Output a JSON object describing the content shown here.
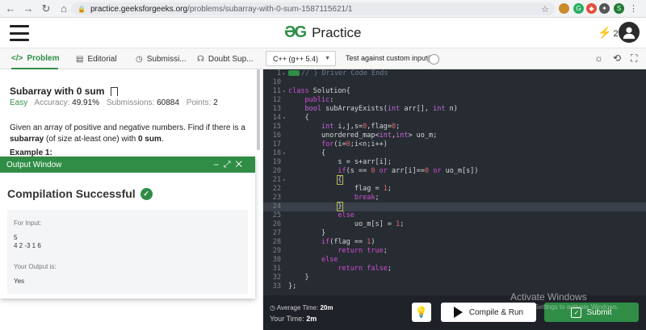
{
  "browser": {
    "url_domain": "practice.geeksforgeeks.org",
    "url_path": "/problems/subarray-with-0-sum-1587115621/1",
    "profile_initial": "S"
  },
  "header": {
    "logo_text": "Practice",
    "streak_count": "2"
  },
  "tabs": [
    {
      "label": "Problem",
      "icon": "code-icon"
    },
    {
      "label": "Editorial",
      "icon": "book-icon"
    },
    {
      "label": "Submissi...",
      "icon": "clock-icon"
    },
    {
      "label": "Doubt Sup...",
      "icon": "headset-icon"
    }
  ],
  "editor_toolbar": {
    "language": "C++ (g++ 5.4)",
    "custom_input_label": "Test against custom input"
  },
  "problem": {
    "title": "Subarray with 0 sum",
    "difficulty": "Easy",
    "accuracy_label": "Accuracy:",
    "accuracy": "49.91%",
    "submissions_label": "Submissions:",
    "submissions": "60884",
    "points_label": "Points:",
    "points": "2",
    "desc_1": "Given an array of positive and negative numbers. Find if there is a ",
    "desc_bold_1": "subarray",
    "desc_2": " (of size at-least one) with ",
    "desc_bold_2": "0 sum",
    "desc_3": ".",
    "example_label": "Example 1:"
  },
  "output": {
    "title": "Output Window",
    "status": "Compilation Successful",
    "for_input_label": "For Input:",
    "input_line_1": "5",
    "input_line_2": "4 2 -3 1 6",
    "your_output_label": "Your Output is:",
    "output_value": "Yes"
  },
  "code": {
    "line_numbers": [
      "1",
      "10",
      "11",
      "12",
      "13",
      "14",
      "15",
      "16",
      "17",
      "18",
      "19",
      "20",
      "21",
      "22",
      "23",
      "24",
      "25",
      "26",
      "27",
      "28",
      "29",
      "30",
      "31",
      "32",
      "33"
    ],
    "driver_comment": "// } Driver Code Ends"
  },
  "bottom": {
    "avg_time_label": "Average Time:",
    "avg_time": "20m",
    "your_time_label": "Your Time:",
    "your_time": "2m",
    "run_label": "Compile & Run",
    "submit_label": "Submit"
  },
  "watermark": {
    "title": "Activate Windows",
    "subtitle": "Go to Settings to activate Windows."
  },
  "colors": {
    "accent": "#2f8d46",
    "editor_bg": "#272c33"
  }
}
